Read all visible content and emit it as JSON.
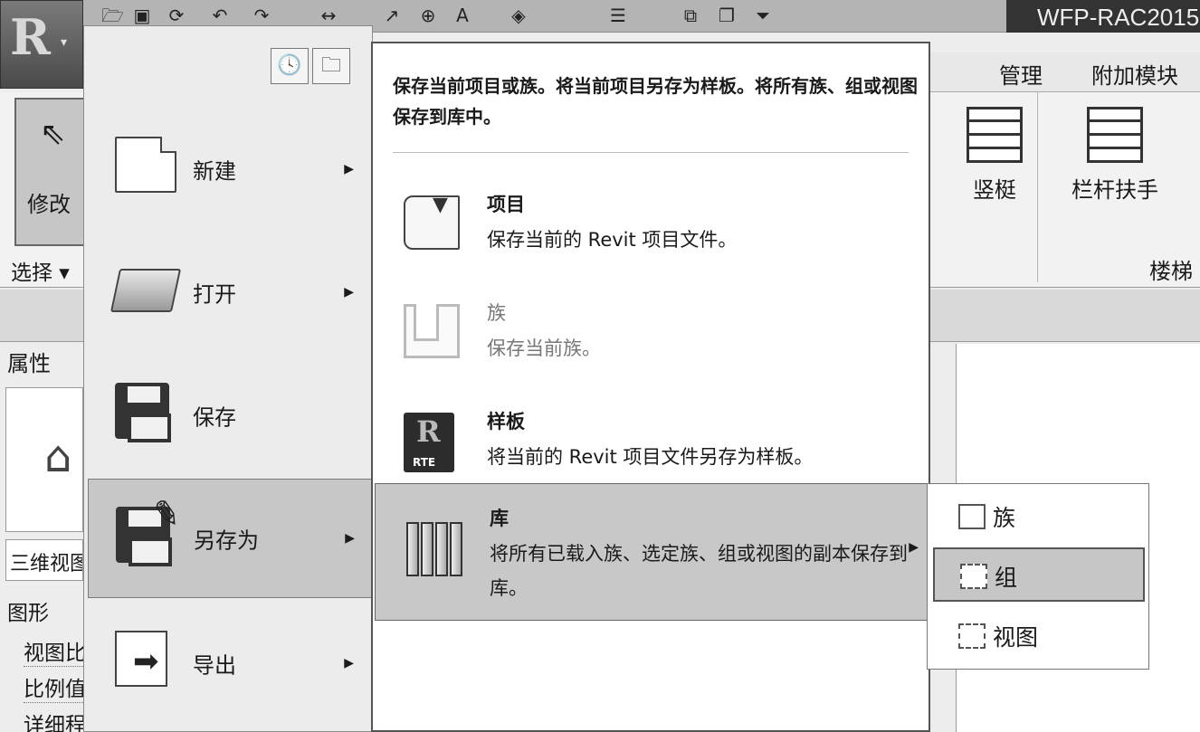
{
  "window": {
    "title": "WFP-RAC2015"
  },
  "ribbon": {
    "tabs": [
      {
        "label": "管理"
      },
      {
        "label": "附加模块"
      }
    ],
    "modify_label": "修改",
    "select_label": "选择 ▾",
    "mullion_label": "竖梃",
    "railing_label": "栏杆扶手",
    "stairs_label": "楼梯"
  },
  "properties": {
    "title": "属性",
    "view_type": "三维视图",
    "graphics": "图形",
    "rows": [
      "视图比例",
      "比例值",
      "详细程度"
    ]
  },
  "app_menu": {
    "items": [
      {
        "label": "新建",
        "icon": "new-document-icon",
        "has_submenu": true
      },
      {
        "label": "打开",
        "icon": "open-folder-icon",
        "has_submenu": true
      },
      {
        "label": "保存",
        "icon": "save-floppy-icon",
        "has_submenu": false
      },
      {
        "label": "另存为",
        "icon": "save-as-icon",
        "has_submenu": true,
        "active": true
      },
      {
        "label": "导出",
        "icon": "export-icon",
        "has_submenu": true
      }
    ]
  },
  "save_as": {
    "description": "保存当前项目或族。将当前项目另存为样板。将所有族、组或视图保存到库中。",
    "items": [
      {
        "title": "项目",
        "desc": "保存当前的 Revit 项目文件。",
        "icon": "project-file-icon",
        "enabled": true
      },
      {
        "title": "族",
        "desc": "保存当前族。",
        "icon": "family-icon",
        "enabled": false
      },
      {
        "title": "样板",
        "desc": "将当前的 Revit 项目文件另存为样板。",
        "icon": "rte-template-icon",
        "icon_text": "RTE",
        "enabled": true
      },
      {
        "title": "库",
        "desc": "将所有已载入族、选定族、组或视图的副本保存到库。",
        "icon": "library-icon",
        "enabled": true,
        "active": true
      }
    ]
  },
  "library_flyout": {
    "items": [
      {
        "label": "族",
        "icon": "family-icon"
      },
      {
        "label": "组",
        "icon": "group-icon",
        "active": true
      },
      {
        "label": "视图",
        "icon": "view-icon"
      }
    ]
  },
  "colors": {
    "active_highlight": "#c7c7c7",
    "title_bar": "#333333"
  }
}
